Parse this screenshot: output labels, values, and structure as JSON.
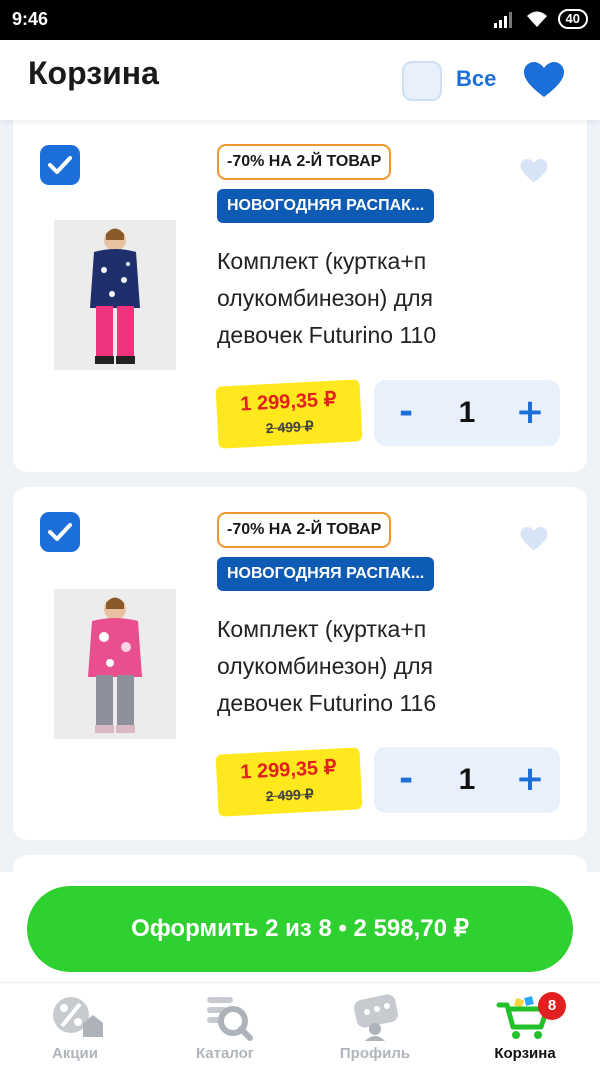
{
  "status_bar": {
    "time": "9:46",
    "battery": "40"
  },
  "header": {
    "title": "Корзина",
    "select_all_label": "Все"
  },
  "cart_items": [
    {
      "promo_badge": "-70% НА 2-Й ТОВАР",
      "campaign_badge": "НОВОГОДНЯЯ РАСПАК...",
      "name_lines": [
        "Комплект (куртка+п",
        "олукомбинезон) для",
        "девочек Futurino 110"
      ],
      "price": "1 299,35 ₽",
      "old_price": "2 499 ₽",
      "quantity": "1",
      "selected": true,
      "jacket_color": "#1e2f6b",
      "pants_color": "#f0337e"
    },
    {
      "promo_badge": "-70% НА 2-Й ТОВАР",
      "campaign_badge": "НОВОГОДНЯЯ РАСПАК...",
      "name_lines": [
        "Комплект (куртка+п",
        "олукомбинезон) для",
        "девочек Futurino 116"
      ],
      "price": "1 299,35 ₽",
      "old_price": "2 499 ₽",
      "quantity": "1",
      "selected": true,
      "jacket_color": "#e94f8f",
      "pants_color": "#8d8f9c"
    }
  ],
  "qty_controls": {
    "minus": "-",
    "plus": "+"
  },
  "checkout": {
    "label": "Оформить 2 из 8 • 2 598,70 ₽"
  },
  "tabbar": {
    "tabs": [
      {
        "label": "Акции",
        "icon": "percent-icon"
      },
      {
        "label": "Каталог",
        "icon": "catalog-search-icon"
      },
      {
        "label": "Профиль",
        "icon": "profile-icon"
      },
      {
        "label": "Корзина",
        "icon": "cart-icon"
      }
    ],
    "cart_badge": "8"
  },
  "colors": {
    "accent_blue": "#1c6fd8",
    "promo_border": "#f0962b",
    "campaign_bg": "#0d5bb5",
    "price_tag": "#ffe81d",
    "price_red": "#e32020",
    "checkout_green": "#2fd130"
  }
}
